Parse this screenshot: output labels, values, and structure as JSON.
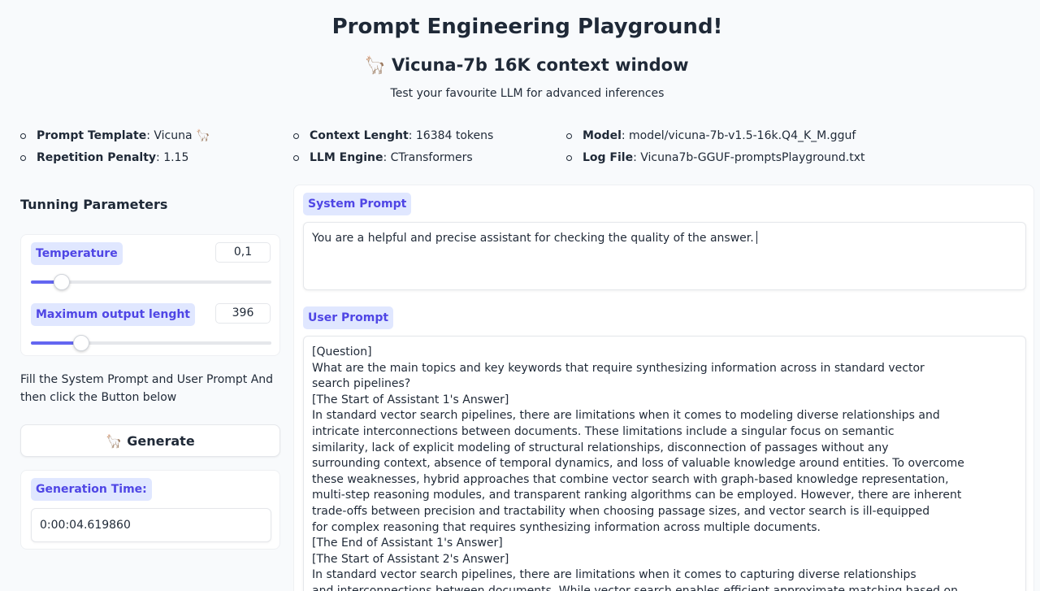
{
  "header": {
    "title": "Prompt Engineering Playground!",
    "subtitle_icon": "🦙",
    "subtitle": "Vicuna-7b 16K context window",
    "tagline": "Test your favourite LLM for advanced inferences"
  },
  "info": {
    "col1": [
      {
        "label": "Prompt Template",
        "value": ": Vicuna 🦙"
      },
      {
        "label": "Repetition Penalty",
        "value": ": 1.15"
      }
    ],
    "col2": [
      {
        "label": "Context Lenght",
        "value": ": 16384 tokens"
      },
      {
        "label": "LLM Engine",
        "value": ": CTransformers"
      }
    ],
    "col3": [
      {
        "label": "Model",
        "value": ": model/vicuna-7b-v1.5-16k.Q4_K_M.gguf"
      },
      {
        "label": "Log File",
        "value": ": Vicuna7b-GGUF-promptsPlayground.txt"
      }
    ]
  },
  "params": {
    "heading": "Tunning Parameters",
    "temperature": {
      "label": "Temperature",
      "value": "0,1",
      "fraction": 0.13
    },
    "max_length": {
      "label": "Maximum output lenght",
      "value": "396",
      "fraction": 0.21
    }
  },
  "instructions": "Fill the System Prompt and User Prompt And then click the Button below",
  "generate": {
    "icon": "🦙",
    "label": "Generate"
  },
  "generation_time": {
    "label": "Generation Time:",
    "value": "0:00:04.619860"
  },
  "system_prompt": {
    "label": "System Prompt",
    "value": "You are a helpful and precise assistant for checking the quality of the answer."
  },
  "user_prompt": {
    "label": "User Prompt",
    "lines": [
      "[Question]",
      "What are the main topics and key keywords that require synthesizing information across in standard vector",
      "search pipelines?",
      "[The Start of Assistant 1's Answer]",
      "In standard vector search pipelines, there are limitations when it comes to modeling diverse relationships and",
      "intricate interconnections between documents. These limitations include a singular focus on semantic",
      "similarity, lack of explicit modeling of structural relationships, disconnection of passages without any",
      "surrounding context, absence of temporal dynamics, and loss of valuable knowledge around entities. To overcome",
      "these weaknesses, hybrid approaches that combine vector search with graph-based knowledge representation,",
      "multi-step reasoning modules, and transparent ranking algorithms can be employed. However, there are inherent",
      "trade-offs between precision and tractability when choosing passage sizes, and vector search is ill-equipped",
      "for complex reasoning that requires synthesizing information across multiple documents.",
      "[The End of Assistant 1's Answer]",
      "[The Start of Assistant 2's Answer]",
      "In standard vector search pipelines, there are limitations when it comes to capturing diverse relationships",
      "and interconnections between documents. While vector search enables efficient approximate matching based on"
    ]
  }
}
